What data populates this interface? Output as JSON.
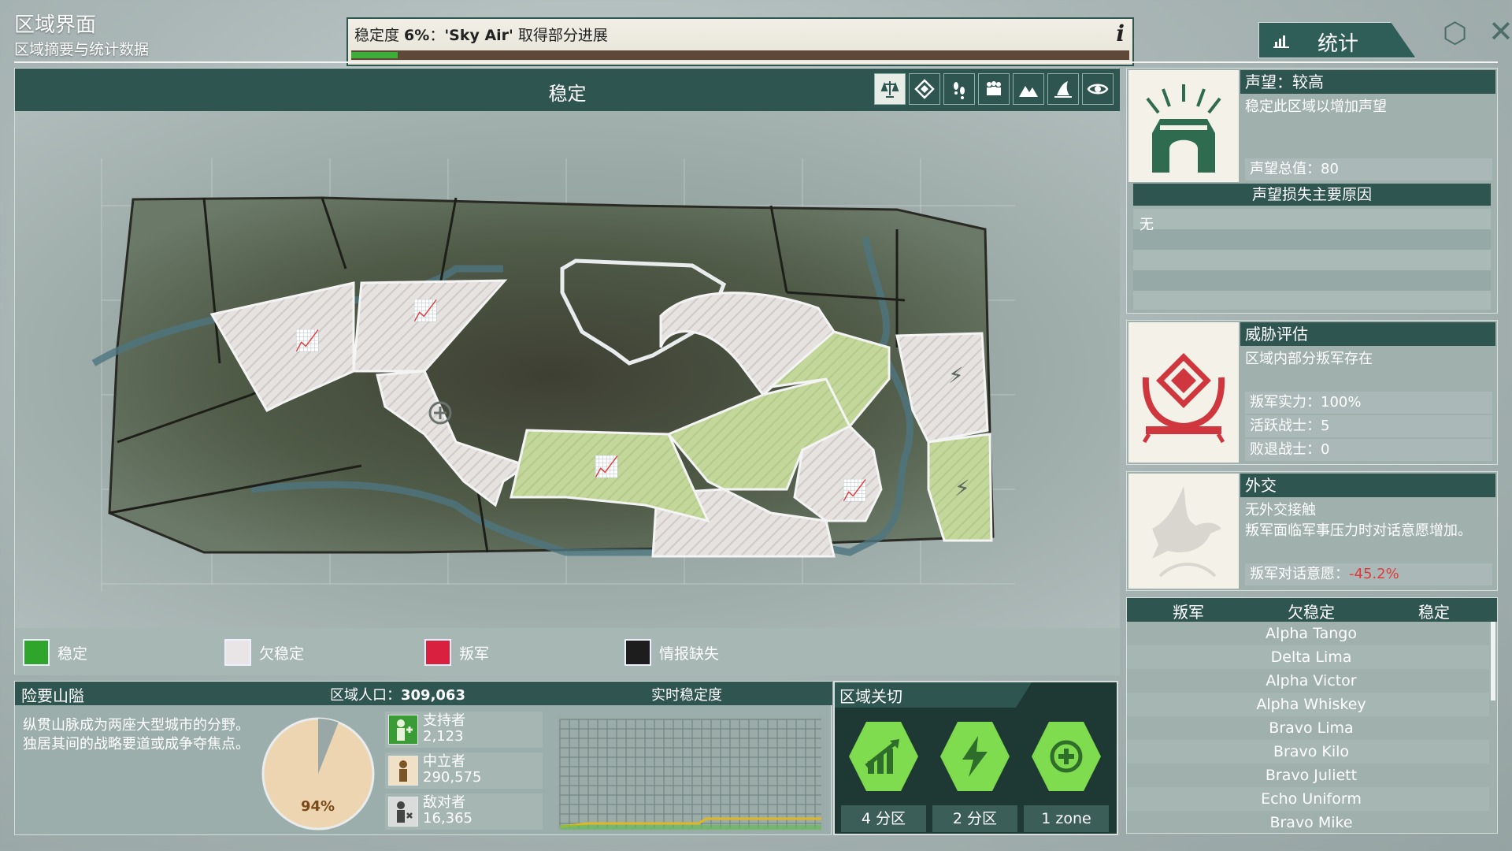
{
  "header": {
    "title": "区域界面",
    "subtitle": "区域摘要与统计数据",
    "progress_prefix": "稳定度 ",
    "progress_pct_text": "6%",
    "progress_sep": "：",
    "progress_faction": "'Sky Air'",
    "progress_suffix": " 取得部分进展",
    "progress_value": 0.06,
    "info_icon": "i",
    "stats_tab_label": "统计"
  },
  "map": {
    "title": "稳定",
    "tools": [
      "balance-icon",
      "diamond-icon",
      "footsteps-icon",
      "people-icon",
      "mountains-icon",
      "sail-icon",
      "eye-icon"
    ],
    "legend": [
      {
        "label": "稳定",
        "color": "#2fa52b"
      },
      {
        "label": "欠稳定",
        "color": "#e9e5e6"
      },
      {
        "label": "叛军",
        "color": "#d9213f"
      },
      {
        "label": "情报缺失",
        "color": "#1d1d1d"
      }
    ]
  },
  "reputation": {
    "title": "声望：较高",
    "desc": "稳定此区域以增加声望",
    "total": "声望总值：80",
    "loss_header": "声望损失主要原因",
    "loss_value": "无"
  },
  "threat": {
    "title": "威胁评估",
    "desc": "区域内部分叛军存在",
    "stats": [
      "叛军实力：100%",
      "活跃战士：5",
      "败退战士：0"
    ]
  },
  "diplomacy": {
    "title": "外交",
    "desc1": "无外交接触",
    "desc2": "叛军面临军事压力时对话意愿增加。",
    "will_label": "叛军对话意愿：",
    "will_value": "-45.2%"
  },
  "factions": {
    "headers": [
      "叛军",
      "欠稳定",
      "稳定"
    ],
    "unstable": [
      "Alpha Tango",
      "Delta Lima",
      "Alpha Victor",
      "Alpha Whiskey",
      "Bravo Lima",
      "Bravo Kilo",
      "Bravo Juliett",
      "Echo Uniform",
      "Bravo Mike"
    ]
  },
  "region": {
    "name": "险要山隘",
    "population_label": "区域人口：",
    "population": "309,063",
    "realtime_label": "实时稳定度",
    "description": "纵贯山脉成为两座大型城市的分野。独居其间的战略要道或成争夺焦点。",
    "pie_pct": "94%",
    "pie_value": 0.94,
    "groups": [
      {
        "name": "支持者",
        "value": "2,123"
      },
      {
        "name": "中立者",
        "value": "290,575"
      },
      {
        "name": "敌对者",
        "value": "16,365"
      }
    ]
  },
  "zones": {
    "title": "区域关切",
    "items": [
      {
        "icon": "chart-up-icon",
        "label": "4 分区"
      },
      {
        "icon": "lightning-icon",
        "label": "2 分区"
      },
      {
        "icon": "medical-cross-icon",
        "label": "1 zone"
      }
    ]
  },
  "colors": {
    "accent": "#2f5550",
    "stable": "#2fa52b",
    "rebel": "#d9213f",
    "negative": "#e03a3a",
    "zone_green": "#7fdc4e"
  }
}
